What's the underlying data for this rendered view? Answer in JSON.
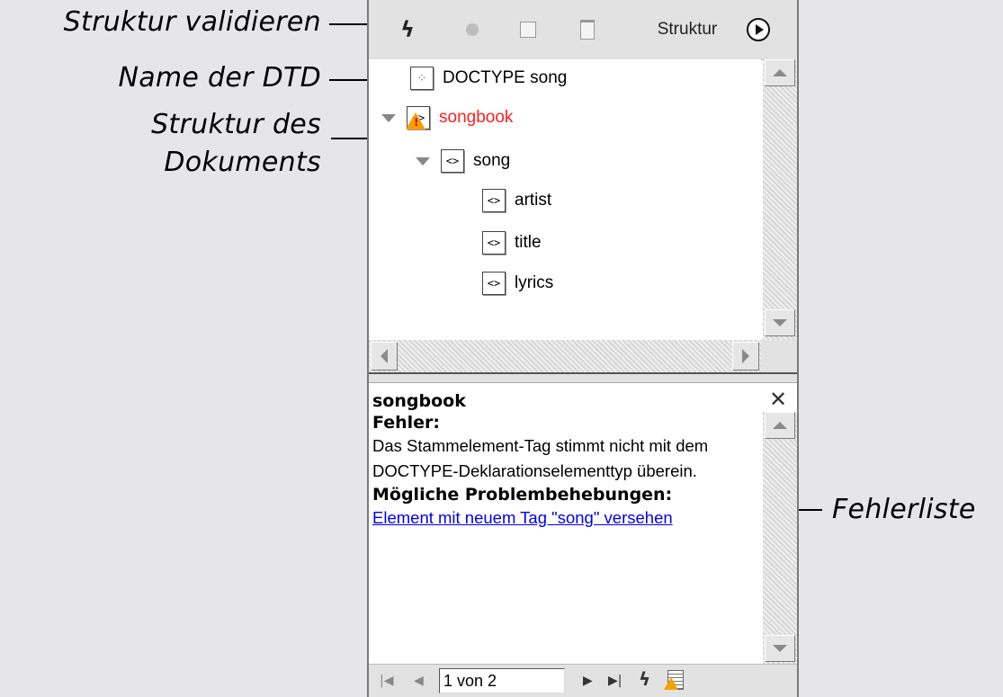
{
  "callouts": {
    "validate": "Struktur validieren",
    "dtd_name": "Name der DTD",
    "doc_structure_line1": "Struktur des",
    "doc_structure_line2": "Dokuments",
    "error_list": "Fehlerliste"
  },
  "toolbar": {
    "validate_icon": "lightning-bolt-icon",
    "label": "Struktur",
    "menu_icon": "play-circle-icon"
  },
  "tree": {
    "doctype": {
      "label": "DOCTYPE song",
      "icon": "doctype-icon"
    },
    "nodes": [
      {
        "label": "songbook",
        "icon": "element-tag-icon",
        "status": "error"
      },
      {
        "label": "song",
        "icon": "element-tag-icon"
      },
      {
        "label": "artist",
        "icon": "element-tag-icon"
      },
      {
        "label": "title",
        "icon": "element-tag-icon"
      },
      {
        "label": "lyrics",
        "icon": "element-tag-icon"
      }
    ]
  },
  "error_panel": {
    "element": "songbook",
    "error_heading": "Fehler:",
    "message": "Das Stammelement-Tag stimmt nicht mit dem DOCTYPE-Deklarationselementtyp überein.",
    "fixes_heading": "Mögliche Problembehebungen:",
    "fix_link": "Element mit neuem Tag \"song\" versehen"
  },
  "statusbar": {
    "page_field": "1 von 2"
  },
  "colors": {
    "error_text": "#ff2020",
    "link": "#0000ee",
    "warning": "#f4a000"
  }
}
